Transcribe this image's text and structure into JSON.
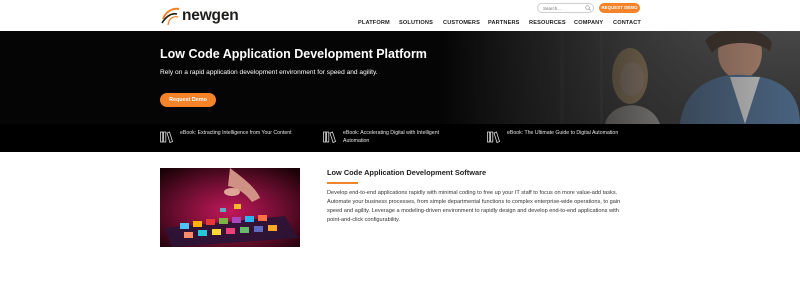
{
  "brand": {
    "name": "newgen",
    "accent": "#f5832a",
    "icon": "newgen-swoosh-logo"
  },
  "header": {
    "search_placeholder": "Search...",
    "search_icon": "search-icon",
    "request_demo_label": "REQUEST DEMO"
  },
  "nav": {
    "items": [
      "PLATFORM",
      "SOLUTIONS",
      "CUSTOMERS",
      "PARTNERS",
      "RESOURCES",
      "COMPANY",
      "CONTACT"
    ]
  },
  "hero": {
    "title": "Low Code Application Development Platform",
    "subtitle": "Rely on a rapid application development environment for speed and agility.",
    "button_label": "Request Demo"
  },
  "ebooks": [
    {
      "label": "eBook: Extracting Intelligence from Your Content",
      "icon": "book-icon"
    },
    {
      "label": "eBook: Accelerating Digital with Intelligent Automation",
      "icon": "book-icon"
    },
    {
      "label": "eBook: The Ultimate Guide to Digital Automation",
      "icon": "book-icon"
    }
  ],
  "section": {
    "title": "Low Code Application Development Software",
    "body": "Develop end-to-end applications rapidly with minimal coding to free up your IT staff to focus on more value-add tasks. Automate your business processes, from simple departmental functions to complex enterprise-wide operations, to gain speed and agility. Leverage a modeling-driven environment to rapidly design and develop end-to-end applications with point-and-click configurability."
  }
}
